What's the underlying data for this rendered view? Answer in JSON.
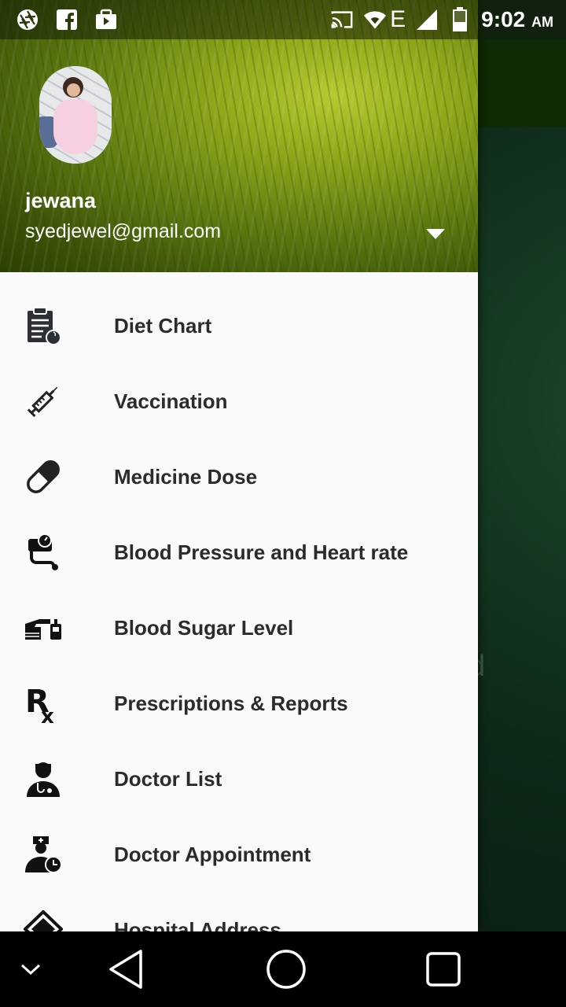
{
  "status_bar": {
    "time": "9:02",
    "ampm": "AM",
    "network": "E",
    "icons": [
      "aperture-icon",
      "facebook-icon",
      "shopping-bag-icon",
      "cast-icon",
      "wifi-icon",
      "signal-icon",
      "battery-icon"
    ]
  },
  "drawer": {
    "user": {
      "name": "jewana",
      "email": "syedjewel@gmail.com"
    },
    "menu_items": [
      {
        "label": "Diet Chart",
        "icon": "diet-chart-icon"
      },
      {
        "label": "Vaccination",
        "icon": "syringe-icon"
      },
      {
        "label": "Medicine Dose",
        "icon": "pill-icon"
      },
      {
        "label": "Blood Pressure and Heart rate",
        "icon": "blood-pressure-icon"
      },
      {
        "label": "Blood Sugar Level",
        "icon": "glucose-meter-icon"
      },
      {
        "label": "Prescriptions & Reports",
        "icon": "rx-icon"
      },
      {
        "label": "Doctor List",
        "icon": "doctor-icon"
      },
      {
        "label": "Doctor Appointment",
        "icon": "doctor-appointment-icon"
      },
      {
        "label": "Hospital Address",
        "icon": "hospital-icon"
      }
    ]
  },
  "background": {
    "faint_text": "d"
  },
  "colors": {
    "header_green": "#8fa81a",
    "drawer_bg": "#fafafa",
    "text_dark": "#2b2b2b"
  }
}
